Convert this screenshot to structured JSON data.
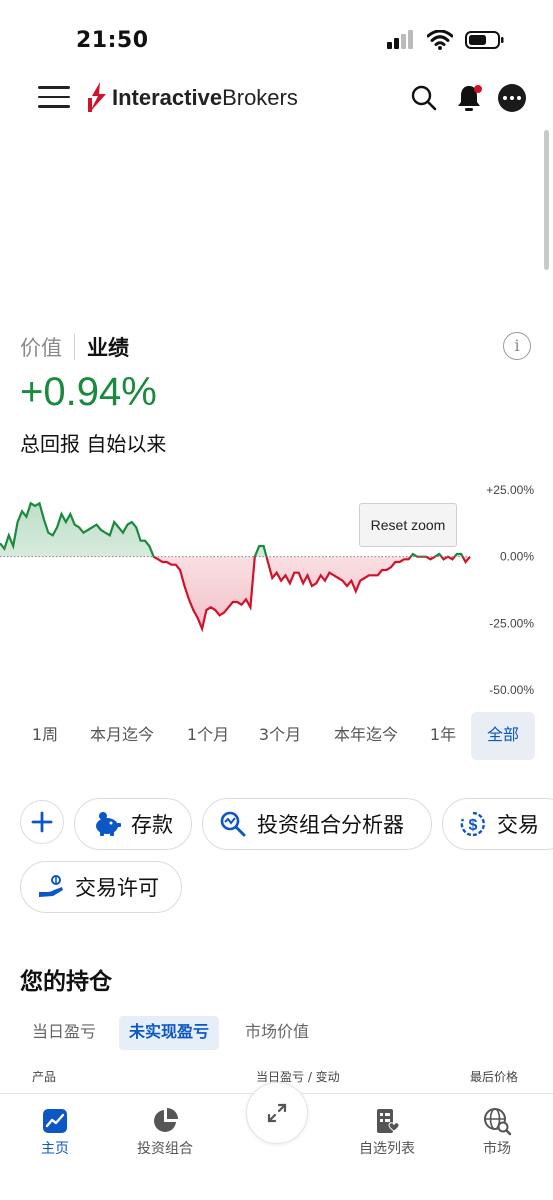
{
  "status_bar": {
    "time": "21:50"
  },
  "header": {
    "logo_bold": "Interactive",
    "logo_light": "Brokers"
  },
  "performance": {
    "tabs": [
      "价值",
      "业绩"
    ],
    "return_value": "+0.94%",
    "return_label": "总回报 自始以来",
    "reset_zoom": "Reset zoom"
  },
  "colors": {
    "positive": "#1a8a3e",
    "negative": "#d0122c",
    "accent": "#0b57c4"
  },
  "chart_data": {
    "type": "line",
    "y_ticks": [
      "+25.00%",
      "0.00%",
      "-25.00%",
      "-50.00%"
    ],
    "ylim": [
      -50,
      25
    ],
    "grid": false,
    "baseline": 0,
    "values": [
      5,
      3,
      8,
      4,
      13,
      17,
      15,
      20,
      19,
      20,
      14,
      9,
      8,
      11,
      16,
      13,
      16,
      12,
      11,
      9,
      10,
      11,
      12,
      10,
      9,
      8,
      13,
      11,
      9,
      12,
      13,
      11,
      6,
      6,
      4,
      0,
      -1,
      -2,
      -2,
      -3,
      -3,
      -5,
      -11,
      -16,
      -20,
      -23,
      -27,
      -20,
      -19,
      -20,
      -22,
      -21,
      -19,
      -17,
      -17,
      -18,
      -16,
      -19,
      0,
      4,
      4,
      -2,
      -8,
      -6,
      -9,
      -7,
      -10,
      -6,
      -6,
      -10,
      -7,
      -11,
      -10,
      -7,
      -9,
      -6,
      -7,
      -8,
      -9,
      -11,
      -9,
      -13,
      -9,
      -8,
      -7,
      -7,
      -7,
      -5,
      -5,
      -4,
      -2,
      -2,
      -1,
      -1,
      1,
      0,
      0,
      0,
      -1,
      0,
      1,
      -1,
      0,
      -1,
      1,
      1,
      -2,
      0
    ]
  },
  "ranges": [
    "1周",
    "本月迄今",
    "1个月",
    "3个月",
    "本年迄今",
    "1年",
    "全部"
  ],
  "actions": {
    "deposit": "存款",
    "portfolio_analyzer": "投资组合分析器",
    "trade": "交易",
    "trade_permission": "交易许可"
  },
  "holdings": {
    "title": "您的持仓",
    "tabs": [
      "当日盈亏",
      "未实现盈亏",
      "市场价值"
    ],
    "columns": [
      "产品",
      "当日盈亏 / 变动",
      "最后价格"
    ]
  },
  "bottom_nav": [
    "主页",
    "投资组合",
    "自选列表",
    "市场"
  ]
}
